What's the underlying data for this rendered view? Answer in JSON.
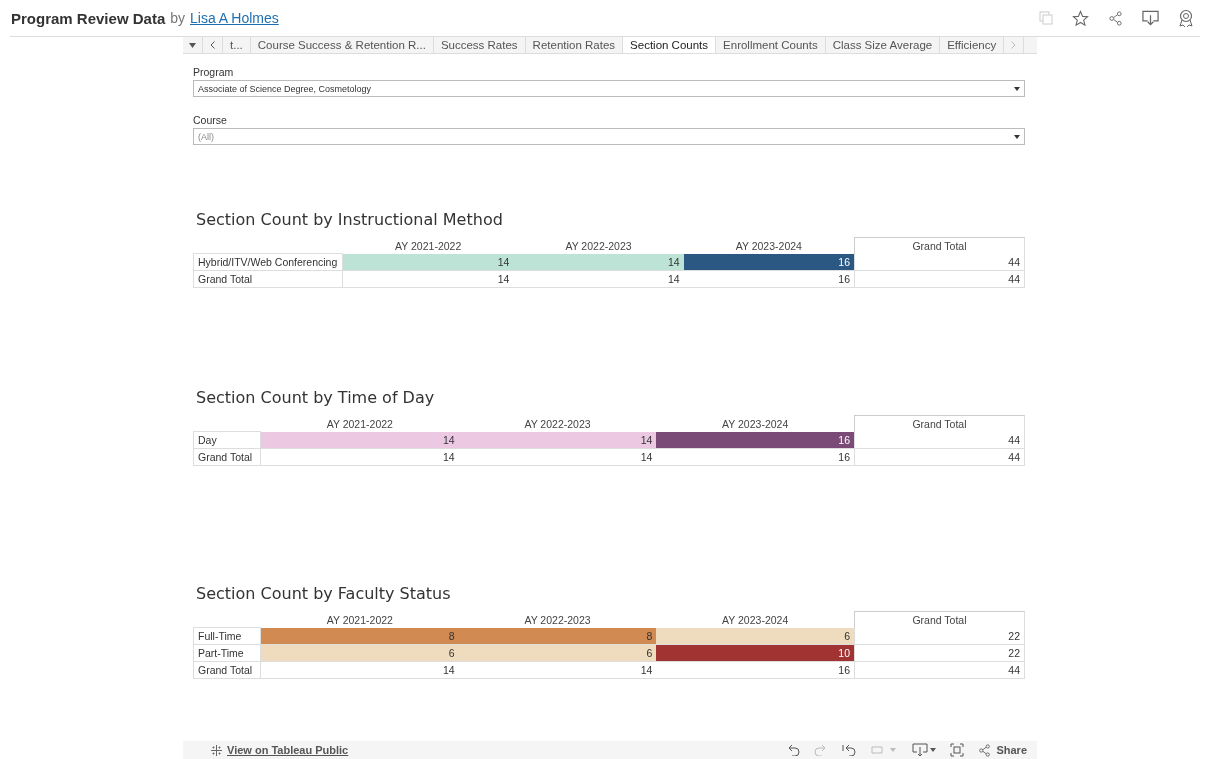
{
  "header": {
    "title": "Program Review Data",
    "by": "by",
    "author": "Lisa A Holmes"
  },
  "tabs": [
    {
      "label": "t...",
      "selected": false
    },
    {
      "label": "Course Success & Retention R...",
      "selected": false
    },
    {
      "label": "Success Rates",
      "selected": false
    },
    {
      "label": "Retention Rates",
      "selected": false
    },
    {
      "label": "Section Counts",
      "selected": true
    },
    {
      "label": "Enrollment Counts",
      "selected": false
    },
    {
      "label": "Class Size Average",
      "selected": false
    },
    {
      "label": "Efficiency",
      "selected": false
    }
  ],
  "filters": [
    {
      "label": "Program",
      "value": "Associate of Science Degree, Cosmetology",
      "dimmed": false
    },
    {
      "label": "Course",
      "value": "(All)",
      "dimmed": true
    }
  ],
  "sections": [
    {
      "title": "Section Count by Instructional Method",
      "columns": [
        "AY 2021-2022",
        "AY 2022-2023",
        "AY 2023-2024"
      ],
      "total_header": "Grand Total",
      "rows": [
        {
          "label": "Hybrid/ITV/Web Conferencing",
          "cells": [
            {
              "value": "14",
              "color": "#bde3d6"
            },
            {
              "value": "14",
              "color": "#bde3d6"
            },
            {
              "value": "16",
              "color": "#2b5783"
            }
          ],
          "total": "44"
        },
        {
          "label": "Grand Total",
          "cells": [
            {
              "value": "14"
            },
            {
              "value": "14"
            },
            {
              "value": "16"
            }
          ],
          "total": "44"
        }
      ]
    },
    {
      "title": "Section Count by Time of Day",
      "columns": [
        "AY 2021-2022",
        "AY 2022-2023",
        "AY 2023-2024"
      ],
      "total_header": "Grand Total",
      "rows": [
        {
          "label": "Day",
          "cells": [
            {
              "value": "14",
              "color": "#ecc8e3"
            },
            {
              "value": "14",
              "color": "#ecc8e3"
            },
            {
              "value": "16",
              "color": "#7b4b78"
            }
          ],
          "total": "44"
        },
        {
          "label": "Grand Total",
          "cells": [
            {
              "value": "14"
            },
            {
              "value": "14"
            },
            {
              "value": "16"
            }
          ],
          "total": "44"
        }
      ]
    },
    {
      "title": "Section Count by Faculty Status",
      "columns": [
        "AY 2021-2022",
        "AY 2022-2023",
        "AY 2023-2024"
      ],
      "total_header": "Grand Total",
      "rows": [
        {
          "label": "Full-Time",
          "cells": [
            {
              "value": "8",
              "color": "#d08a52"
            },
            {
              "value": "8",
              "color": "#d08a52"
            },
            {
              "value": "6",
              "color": "#efdbbd"
            }
          ],
          "total": "22"
        },
        {
          "label": "Part-Time",
          "cells": [
            {
              "value": "6",
              "color": "#efdbbd"
            },
            {
              "value": "6",
              "color": "#efdbbd"
            },
            {
              "value": "10",
              "color": "#a13432"
            }
          ],
          "total": "22"
        },
        {
          "label": "Grand Total",
          "cells": [
            {
              "value": "14"
            },
            {
              "value": "14"
            },
            {
              "value": "16"
            }
          ],
          "total": "44"
        }
      ]
    }
  ],
  "toolbar": {
    "view_link": "View on Tableau Public",
    "share": "Share"
  }
}
